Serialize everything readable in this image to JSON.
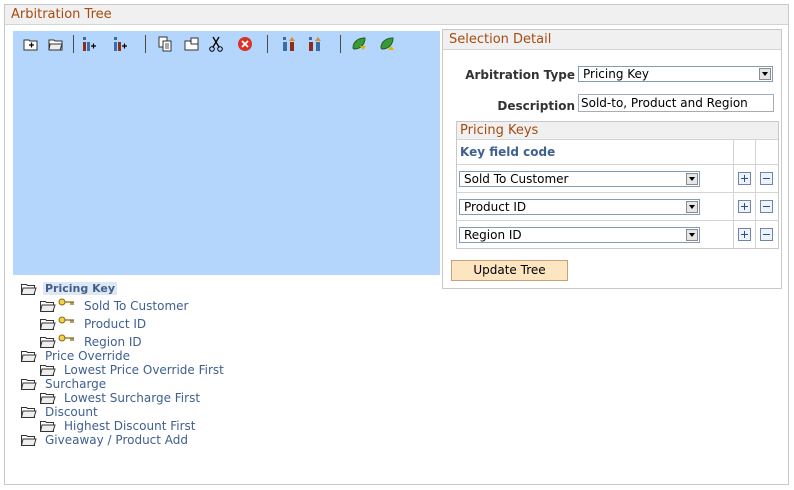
{
  "page": {
    "title": "Arbitration Tree"
  },
  "toolbar": {
    "icons": [
      "insert-child-icon",
      "insert-sibling-icon",
      "add-node-child-icon",
      "add-node-sibling-icon",
      "copy-icon",
      "paste-icon",
      "cut-icon",
      "delete-icon",
      "move-up-icon",
      "move-down-icon",
      "expand-leaf-icon",
      "collapse-leaf-icon"
    ]
  },
  "tree": {
    "nodes": [
      {
        "label": "Pricing Key",
        "level": 0,
        "selected": true
      },
      {
        "label": "Sold To Customer",
        "level": 1,
        "key": true
      },
      {
        "label": "Product ID",
        "level": 1,
        "key": true
      },
      {
        "label": "Region ID",
        "level": 1,
        "key": true
      },
      {
        "label": "Price Override",
        "level": 0
      },
      {
        "label": "Lowest Price Override First",
        "level": 1
      },
      {
        "label": "Surcharge",
        "level": 0
      },
      {
        "label": "Lowest Surcharge First",
        "level": 1
      },
      {
        "label": "Discount",
        "level": 0
      },
      {
        "label": "Highest Discount First",
        "level": 1
      },
      {
        "label": "Giveaway / Product Add",
        "level": 0
      }
    ]
  },
  "detail": {
    "title": "Selection Detail",
    "arbitration_type_label": "Arbitration Type",
    "arbitration_type_value": "Pricing Key",
    "description_label": "Description",
    "description_value": "Sold-to, Product and Region",
    "grid_title": "Pricing Keys",
    "grid_column": "Key field code",
    "rows": [
      "Sold To Customer",
      "Product ID",
      "Region ID"
    ],
    "update_button": "Update Tree"
  },
  "colors": {
    "accent": "#a64b11",
    "tree_bg": "#b5d6fc",
    "link": "#3f5f8f",
    "button_bg": "#fde5c2"
  }
}
